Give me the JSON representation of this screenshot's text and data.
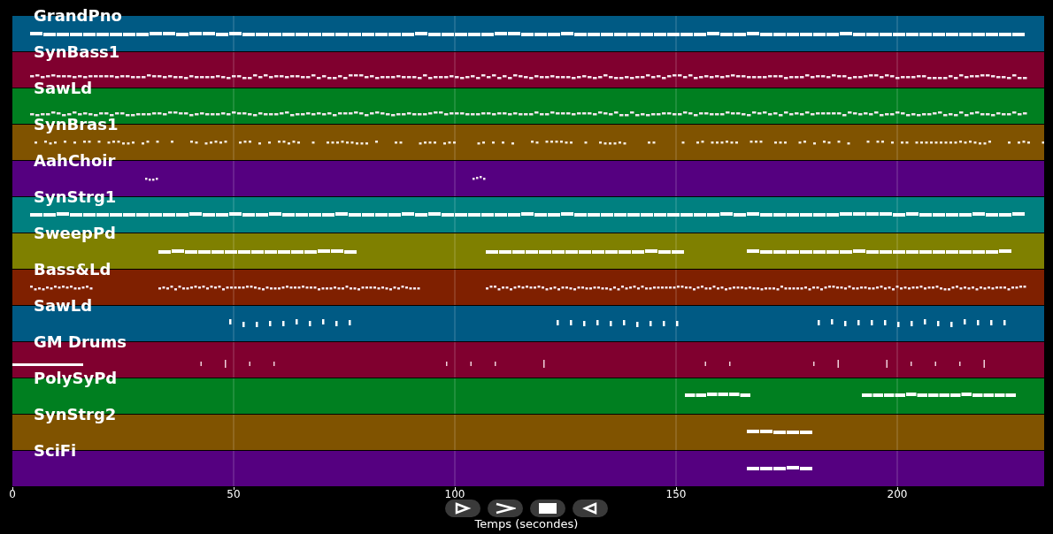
{
  "tracks": [
    {
      "name": "GrandPno",
      "color": "#005a84"
    },
    {
      "name": "SynBass1",
      "color": "#80002f"
    },
    {
      "name": "SawLd",
      "color": "#007f20"
    },
    {
      "name": "SynBras1",
      "color": "#805300"
    },
    {
      "name": "AahChoir",
      "color": "#550080"
    },
    {
      "name": "SynStrg1",
      "color": "#008080"
    },
    {
      "name": "SweepPd",
      "color": "#7f8000"
    },
    {
      "name": "Bass&Ld",
      "color": "#7f2000"
    },
    {
      "name": "SawLd",
      "color": "#005a84"
    },
    {
      "name": "GM Drums",
      "color": "#80002f"
    },
    {
      "name": "PolySyPd",
      "color": "#007f20"
    },
    {
      "name": "SynStrg2",
      "color": "#805300"
    },
    {
      "name": "SciFi",
      "color": "#550080"
    }
  ],
  "axis": {
    "ticks": [
      "0",
      "50",
      "100",
      "150",
      "200"
    ],
    "label": "Temps (secondes)"
  }
}
